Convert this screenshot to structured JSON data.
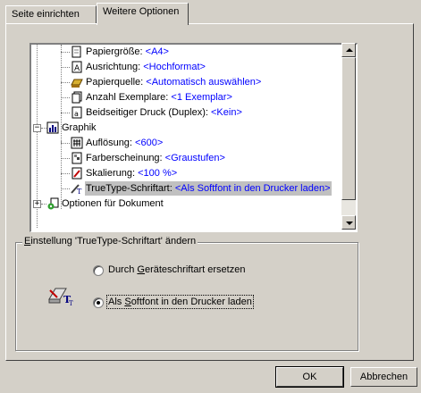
{
  "tabs": [
    {
      "label": "Seite einrichten",
      "active": false
    },
    {
      "label": "Weitere Optionen",
      "active": true
    }
  ],
  "tree": {
    "items": [
      {
        "label": "Papiergröße:",
        "value": "<A4>",
        "icon": "page-size-icon"
      },
      {
        "label": "Ausrichtung:",
        "value": "<Hochformat>",
        "icon": "orientation-icon"
      },
      {
        "label": "Papierquelle:",
        "value": "<Automatisch auswählen>",
        "icon": "paper-tray-icon"
      },
      {
        "label": "Anzahl Exemplare:",
        "value": "<1 Exemplar>",
        "icon": "copies-icon"
      },
      {
        "label": "Beidseitiger Druck (Duplex):",
        "value": "<Kein>",
        "icon": "duplex-icon"
      },
      {
        "label": "Graphik",
        "icon": "graphics-icon"
      },
      {
        "label": "Auflösung:",
        "value": "<600>",
        "icon": "resolution-icon"
      },
      {
        "label": "Farberscheinung:",
        "value": "<Graustufen>",
        "icon": "color-icon"
      },
      {
        "label": "Skalierung:",
        "value": "<100 %>",
        "icon": "scaling-icon"
      },
      {
        "label": "TrueType-Schriftart:",
        "value": "<Als Softfont in den Drucker laden>",
        "icon": "truetype-icon"
      },
      {
        "label": "Optionen für Dokument",
        "icon": "document-options-icon"
      }
    ]
  },
  "group": {
    "label_prefix": "E",
    "label_rest": "instellung 'TrueType-Schriftart' ändern",
    "options": [
      {
        "pre": "Durch ",
        "ul": "G",
        "post": "eräteschriftart ersetzen",
        "selected": false
      },
      {
        "pre": "Als ",
        "ul": "S",
        "post": "oftfont in den Drucker laden",
        "selected": true
      }
    ]
  },
  "buttons": {
    "ok": "OK",
    "cancel": "Abbrechen"
  },
  "colors": {
    "dialog": "#d4d0c8",
    "value_text": "#0000ff",
    "selection": "#c0c0c0"
  }
}
